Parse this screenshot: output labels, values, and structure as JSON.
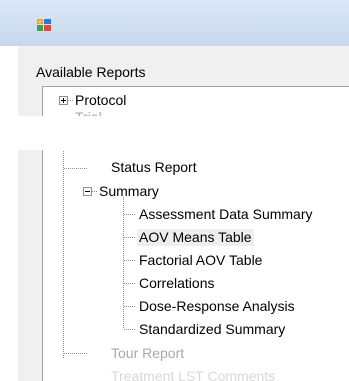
{
  "window": {
    "title": ""
  },
  "report_group": {
    "label": "Available Reports"
  },
  "tree": {
    "top_items": [
      {
        "label": "Protocol"
      },
      {
        "label": "Trial"
      }
    ],
    "items": [
      {
        "label": "Status Report"
      },
      {
        "label": "Summary",
        "children": [
          {
            "label": "Assessment Data Summary"
          },
          {
            "label": "AOV Means Table"
          },
          {
            "label": "Factorial AOV Table"
          },
          {
            "label": "Correlations"
          },
          {
            "label": "Dose-Response Analysis"
          },
          {
            "label": "Standardized Summary"
          }
        ]
      },
      {
        "label": "Tour Report"
      },
      {
        "label": "Treatment LST Comments"
      }
    ]
  },
  "colors": {
    "titlebar": "#c7d8ee",
    "tree_line": "#8e8f8f",
    "faded_text": "#a8a8a8"
  }
}
